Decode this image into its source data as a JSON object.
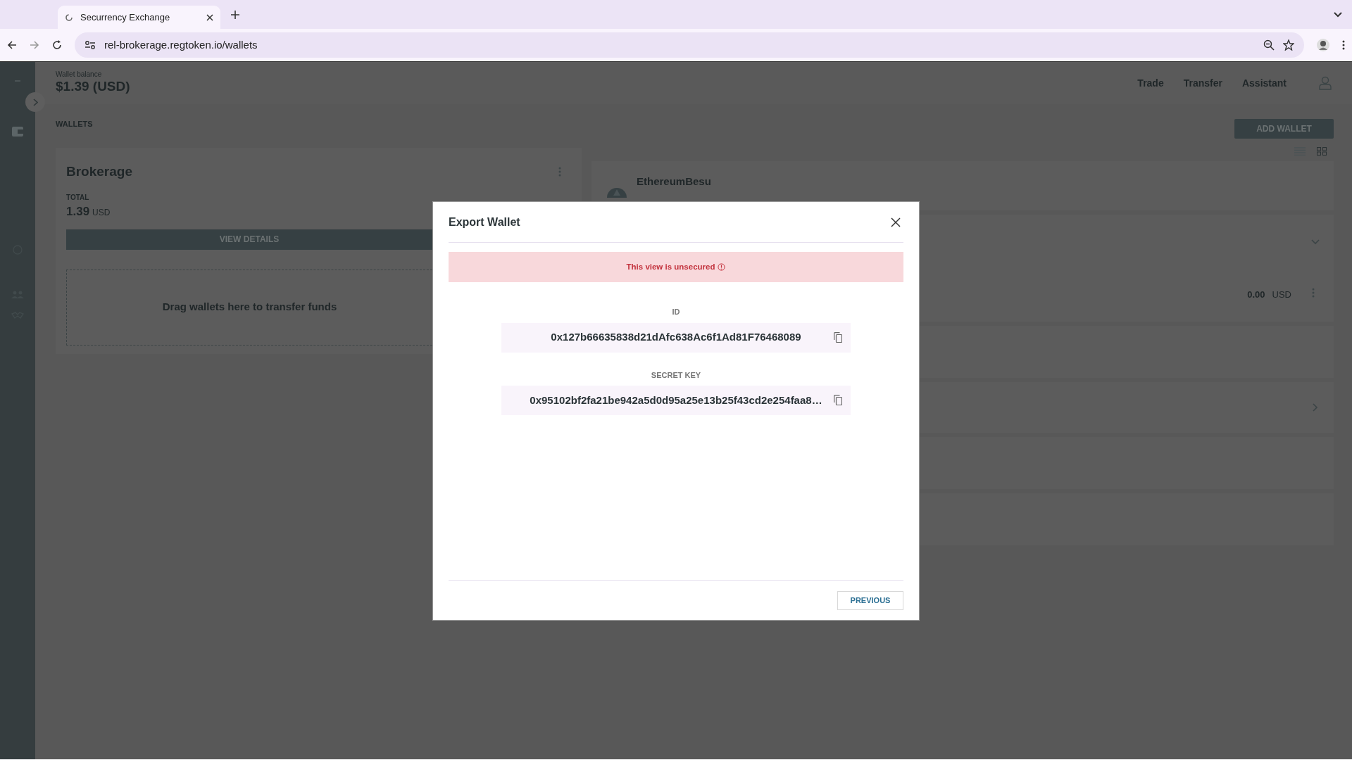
{
  "browser": {
    "tab_title": "Securrency Exchange",
    "url": "rel-brokerage.regtoken.io/wallets"
  },
  "header": {
    "balance_label": "Wallet balance",
    "balance": "$1.39 (USD)",
    "nav": [
      {
        "label": "Trade"
      },
      {
        "label": "Transfer"
      },
      {
        "label": "Assistant"
      }
    ]
  },
  "wallets": {
    "title": "WALLETS",
    "add_button": "ADD WALLET",
    "brokerage": {
      "name": "Brokerage",
      "total_label": "TOTAL",
      "amount": "1.39",
      "currency": "USD",
      "view_button": "VIEW DETAILS",
      "drop_hint": "Drag wallets here to transfer funds"
    },
    "right_cards": [
      {
        "kind": "network",
        "name": "EthereumBesu"
      },
      {
        "kind": "group",
        "amount": "0.00",
        "currency": "USD"
      },
      {
        "kind": "plain"
      },
      {
        "kind": "link"
      },
      {
        "kind": "plain"
      },
      {
        "kind": "plain"
      }
    ]
  },
  "modal": {
    "title": "Export Wallet",
    "alert": "This view is unsecured",
    "fields": [
      {
        "label": "ID",
        "value": "0x127b66635838d21dAfc638Ac6f1Ad81F76468089"
      },
      {
        "label": "SECRET KEY",
        "value": "0x95102bf2fa21be942a5d0d95a25e13b25f43cd2e254faa8…"
      }
    ],
    "buttons": [
      {
        "label": "PREVIOUS"
      }
    ]
  }
}
